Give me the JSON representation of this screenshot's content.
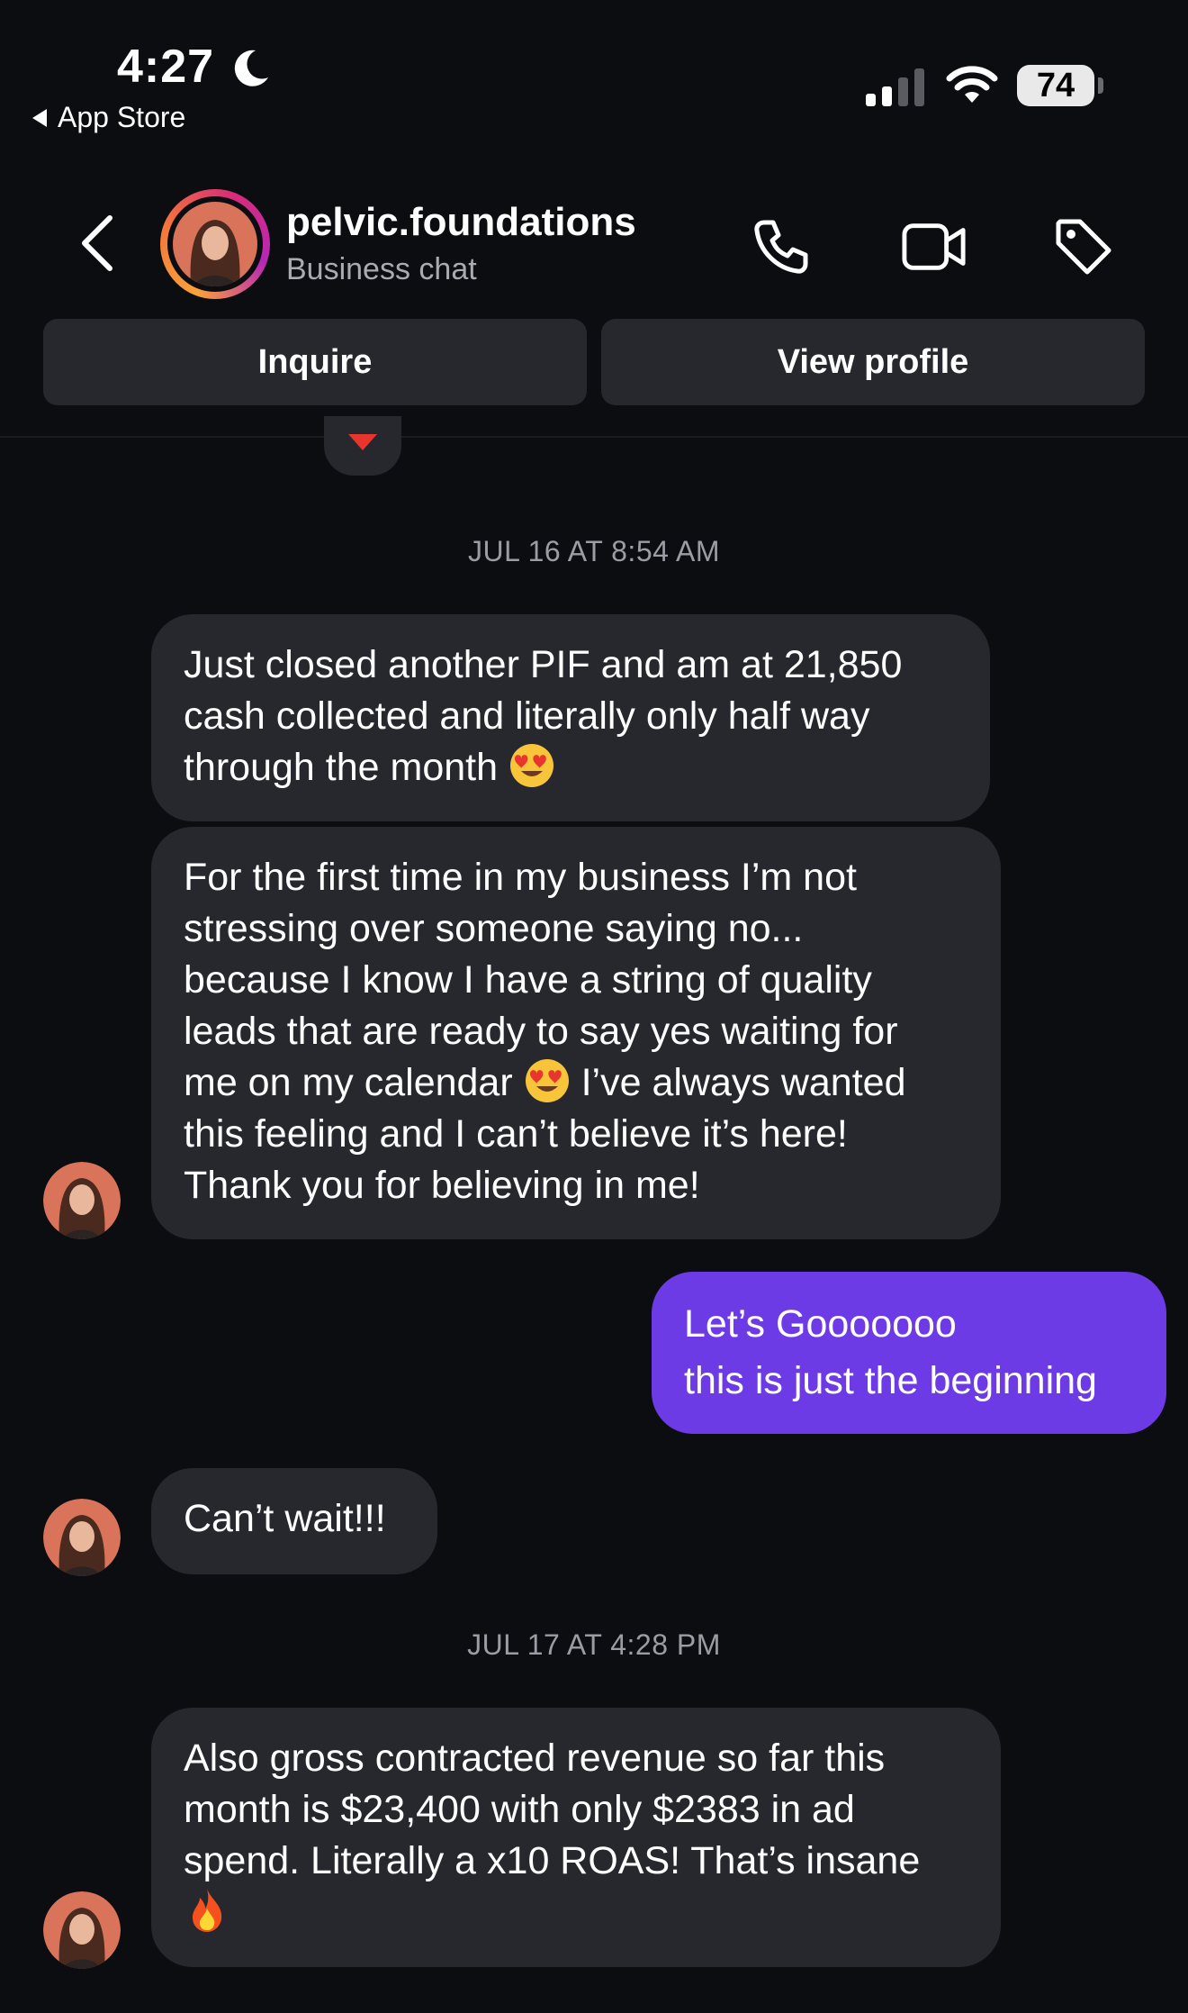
{
  "status_bar": {
    "time": "4:27",
    "back_app": "App Store",
    "battery": "74"
  },
  "header": {
    "name": "pelvic.foundations",
    "subtitle": "Business chat",
    "inquire_label": "Inquire",
    "view_profile_label": "View profile"
  },
  "thread": {
    "timestamp_1": "JUL 16 AT 8:54 AM",
    "msg_1": "Just closed another PIF and am at 21,850\ncash collected and literally only half way\nthrough the month",
    "msg_2a": "For the first time in my business I’m not\nstressing over someone saying no...\nbecause I know I have a string of quality\nleads that are ready to say yes waiting for\nme on my calendar",
    "msg_2b": "I’ve always wanted\nthis feeling and I can’t believe it’s here!\nThank you for believing in me!",
    "msg_out_line1": "Let’s Gooooooo",
    "msg_out_line2": "this is just the beginning",
    "msg_3": "Can’t wait!!!",
    "timestamp_2": "JUL 17 AT 4:28 PM",
    "msg_4": "Also gross contracted revenue so far this\nmonth is $23,400 with only $2383 in ad\nspend. Literally a x10 ROAS! That’s insane"
  },
  "colors": {
    "background": "#0c0d11",
    "bubble_in": "#26282e",
    "bubble_out": "#6d3be5",
    "muted_text": "#9b9da4"
  },
  "icons": [
    "moon-icon",
    "signal-icon",
    "wifi-icon",
    "battery-icon",
    "chevron-left-icon",
    "phone-icon",
    "video-icon",
    "tag-icon",
    "heart-eyes-emoji",
    "fire-emoji",
    "heart-reaction-icon"
  ]
}
